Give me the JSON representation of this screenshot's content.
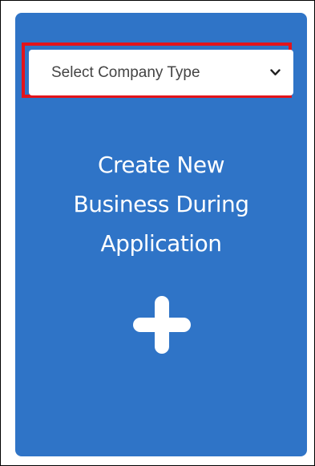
{
  "card": {
    "select": {
      "selected": "Select Company Type"
    },
    "title_lines": [
      "Create New",
      "Business During",
      "Application"
    ],
    "icons": {
      "chevron": "chevron-down-icon",
      "plus": "plus-icon"
    }
  },
  "colors": {
    "card_background": "#2f74c7",
    "highlight_border": "#e3141b",
    "text_on_card": "#ffffff"
  }
}
